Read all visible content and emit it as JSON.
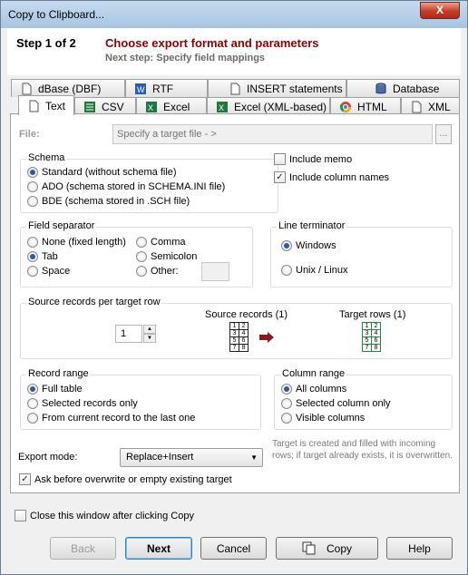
{
  "window": {
    "title": "Copy to Clipboard...",
    "close": "X"
  },
  "header": {
    "step": "Step 1 of 2",
    "title": "Choose export format and parameters",
    "next": "Next step: Specify field mappings"
  },
  "tabs_back": [
    "dBase (DBF)",
    "RTF",
    "INSERT statements",
    "Database"
  ],
  "tabs_front": [
    "Text",
    "CSV",
    "Excel",
    "Excel (XML-based)",
    "HTML",
    "XML"
  ],
  "file": {
    "label": "File:",
    "placeholder": "Specify a target file - >",
    "browse": "..."
  },
  "schema": {
    "label": "Schema",
    "options": [
      "Standard (without schema file)",
      "ADO (schema stored in SCHEMA.INI file)",
      "BDE (schema stored in .SCH file)"
    ],
    "selected": 0
  },
  "include_memo": {
    "label": "Include memo",
    "checked": false
  },
  "include_column_names": {
    "label": "Include column names",
    "checked": true
  },
  "field_separator": {
    "label": "Field separator",
    "options": [
      "None (fixed length)",
      "Tab",
      "Space",
      "Comma",
      "Semicolon",
      "Other:"
    ],
    "selected": 1
  },
  "line_terminator": {
    "label": "Line terminator",
    "options": [
      "Windows",
      "Unix / Linux"
    ],
    "selected": 0
  },
  "records_per_row": {
    "label": "Source records per target row",
    "value": "1",
    "source_caption": "Source records (1)",
    "target_caption": "Target rows (1)",
    "grid_cells": [
      "1",
      "2",
      "3",
      "4",
      "5",
      "6",
      "7",
      "8"
    ]
  },
  "record_range": {
    "label": "Record range",
    "options": [
      "Full table",
      "Selected records only",
      "From current record to the last one"
    ],
    "selected": 0
  },
  "column_range": {
    "label": "Column range",
    "options": [
      "All columns",
      "Selected column only",
      "Visible columns"
    ],
    "selected": 0
  },
  "export_mode": {
    "label": "Export mode:",
    "value": "Replace+Insert",
    "hint": "Target is created and filled with incoming rows; if target already exists, it is overwritten."
  },
  "ask_overwrite": {
    "label": "Ask before overwrite or empty existing target",
    "checked": true
  },
  "close_after": {
    "label": "Close this window after clicking Copy",
    "checked": false
  },
  "buttons": {
    "back": "Back",
    "next": "Next",
    "cancel": "Cancel",
    "copy": "Copy",
    "help": "Help"
  },
  "colors": {
    "accent_title": "#8b0000",
    "radio_dot": "#2f5a9e",
    "grid_green": "#1e8c3a",
    "arrow": "#8b1a1a"
  }
}
